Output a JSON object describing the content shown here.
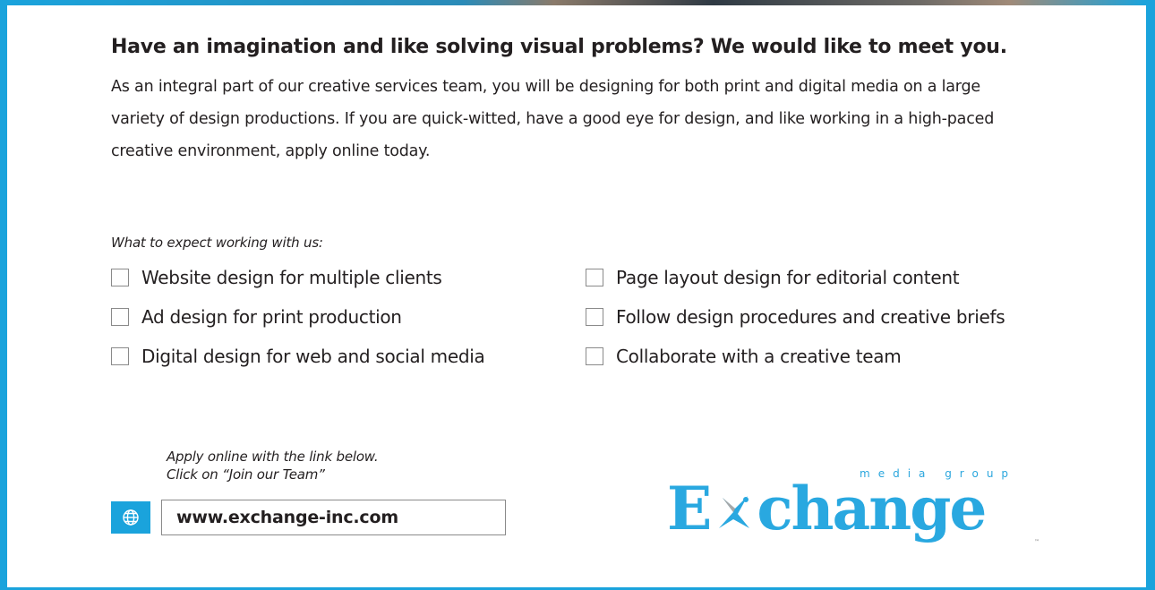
{
  "headline": "Have an imagination and like solving visual problems? We would like to meet you.",
  "intro": "As an integral part of our creative services team, you will be designing for both print and digital media on a large variety of design productions. If you are quick-witted, have a good eye for design, and like working in a high-paced creative environment, apply online today.",
  "expect_label": "What to expect working with us:",
  "checklist": [
    "Website design for multiple clients",
    "Page layout design for editorial content",
    "Ad design for print production",
    "Follow design procedures and creative briefs",
    "Digital design for web and social media",
    "Collaborate with a creative team"
  ],
  "apply": {
    "line1": "Apply online with the link below.",
    "line2": "Click on “Join our Team”",
    "url": "www.exchange-inc.com",
    "icon": "globe-icon"
  },
  "logo": {
    "word_start": "E",
    "word_end": "change",
    "tagline": "media group",
    "tm": "™"
  },
  "colors": {
    "accent": "#1aa3dc",
    "logo": "#29a8e0",
    "text": "#231f20"
  }
}
